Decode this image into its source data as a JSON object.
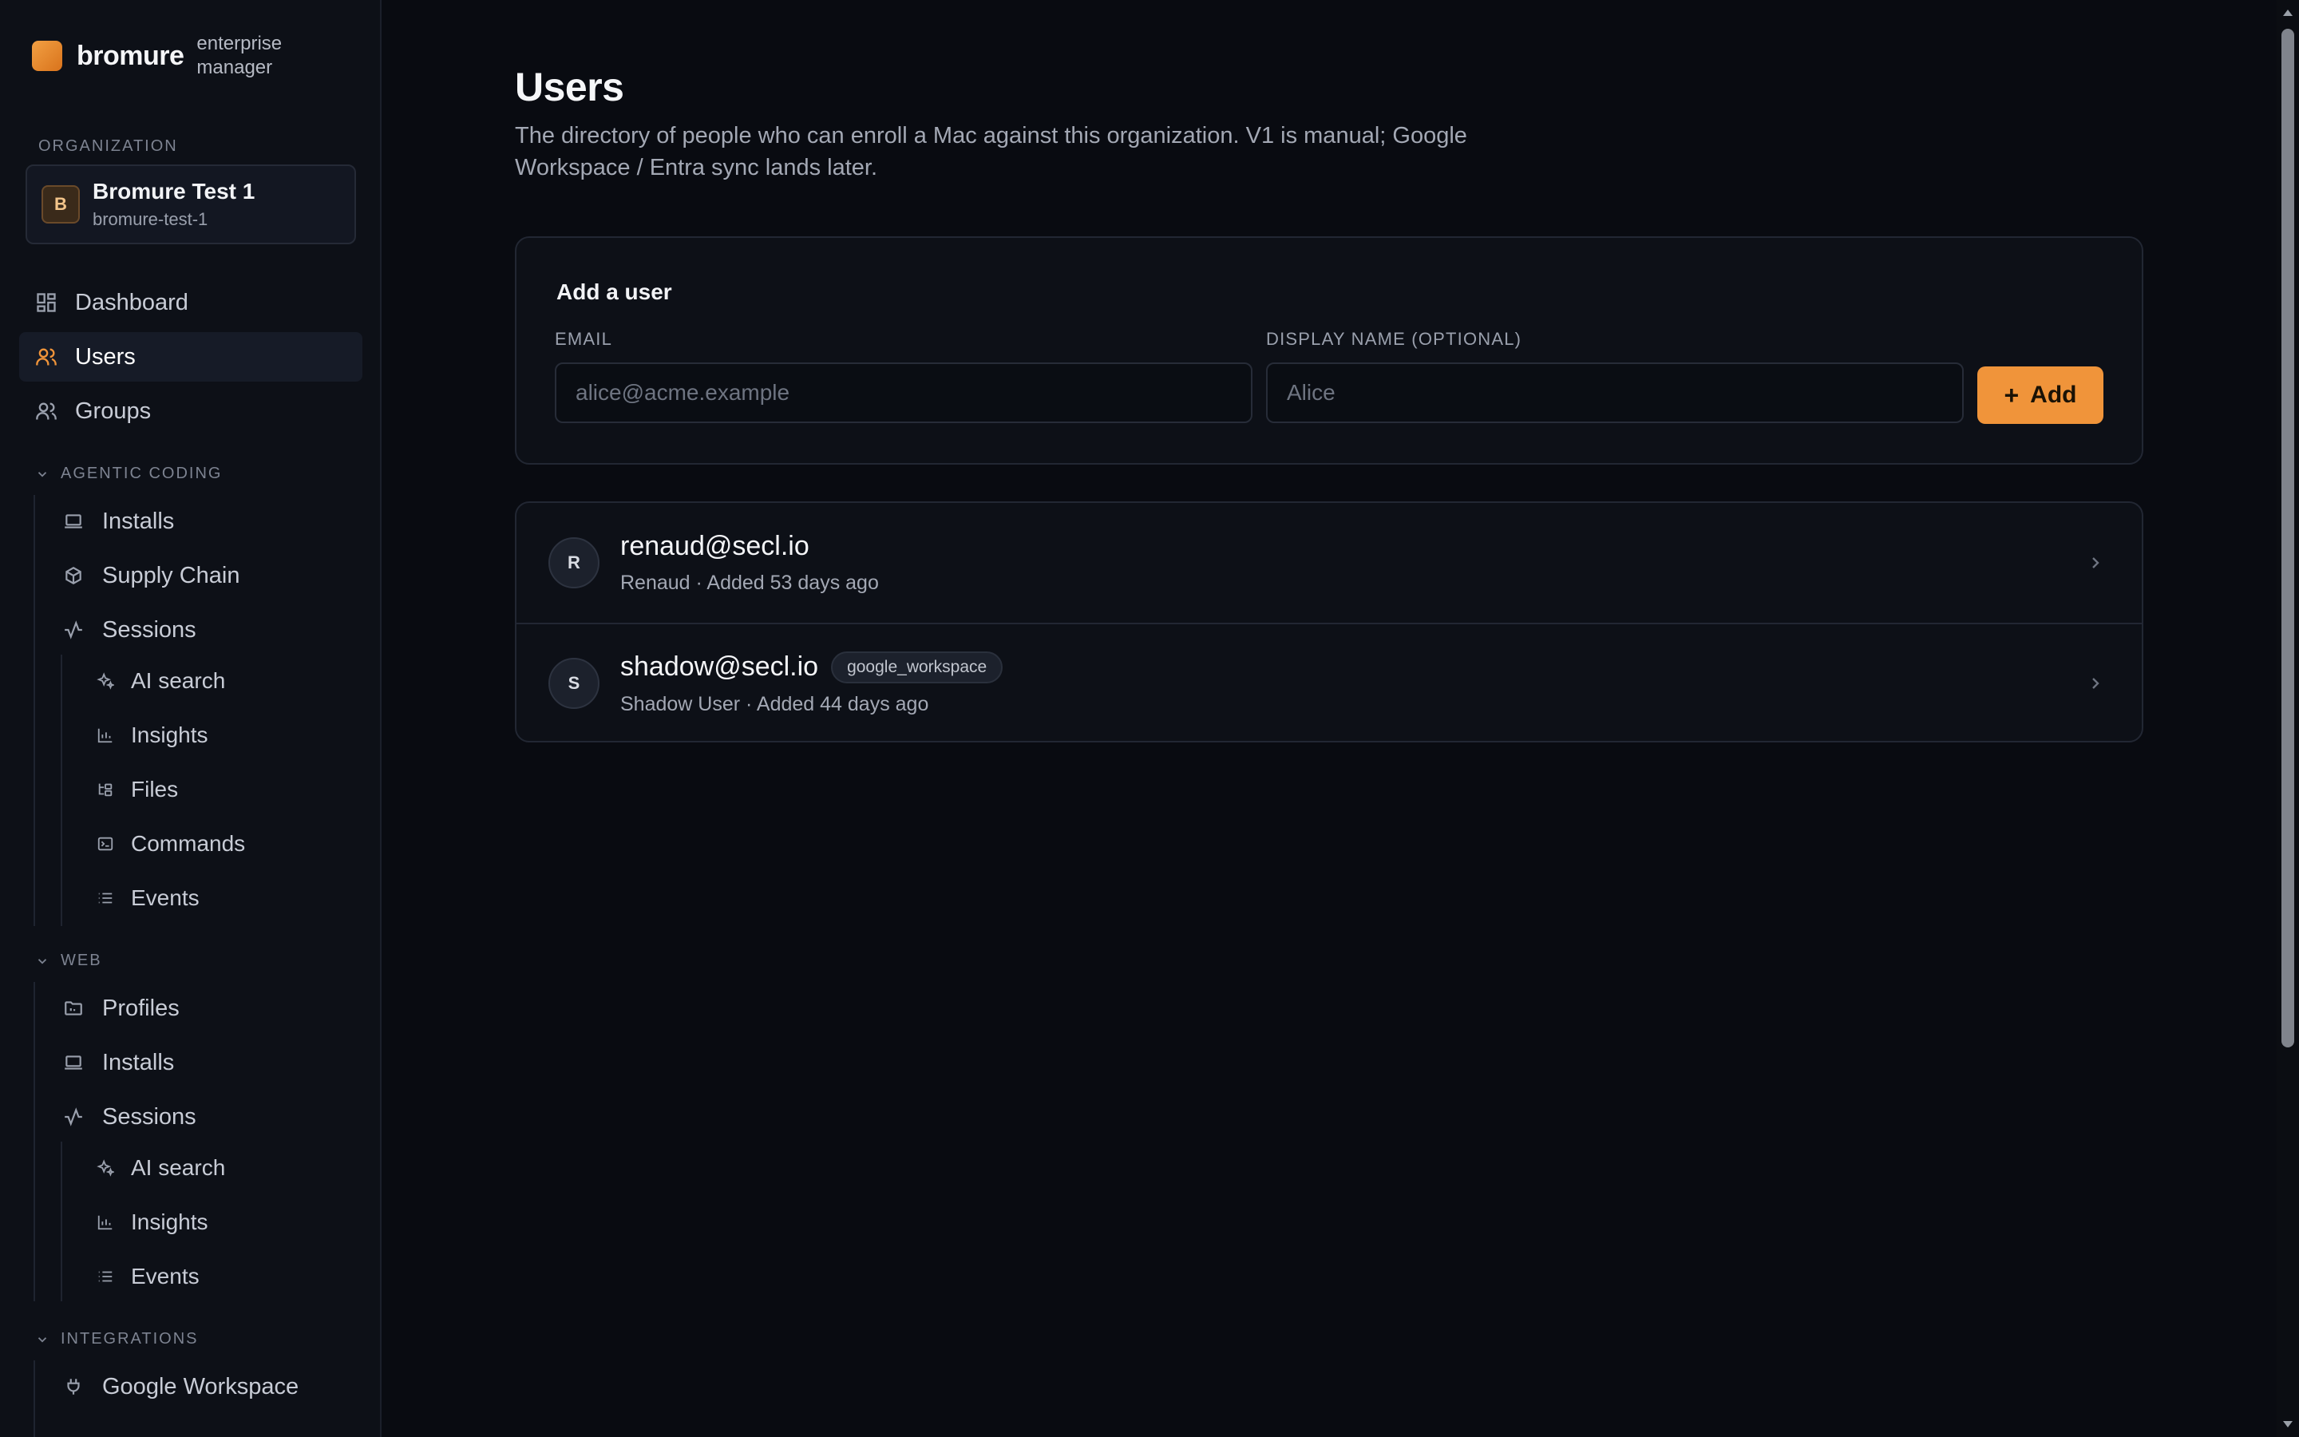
{
  "brand": {
    "name": "bromure",
    "subtitle": "enterprise manager",
    "color": "#f0943a"
  },
  "organization": {
    "label": "ORGANIZATION",
    "avatar": "B",
    "name": "Bromure Test 1",
    "slug": "bromure-test-1"
  },
  "nav": {
    "dashboard": "Dashboard",
    "users": "Users",
    "groups": "Groups",
    "agentic": {
      "title": "AGENTIC CODING",
      "installs": "Installs",
      "supply_chain": "Supply Chain",
      "sessions": "Sessions",
      "ai_search": "AI search",
      "insights": "Insights",
      "files": "Files",
      "commands": "Commands",
      "events": "Events"
    },
    "web": {
      "title": "WEB",
      "profiles": "Profiles",
      "installs": "Installs",
      "sessions": "Sessions",
      "ai_search": "AI search",
      "insights": "Insights",
      "events": "Events"
    },
    "integrations": {
      "title": "INTEGRATIONS",
      "google_workspace": "Google Workspace"
    }
  },
  "page": {
    "title": "Users",
    "description": "The directory of people who can enroll a Mac against this organization. V1 is manual; Google Workspace / Entra sync lands later."
  },
  "add_user": {
    "title": "Add a user",
    "email_label": "EMAIL",
    "email_placeholder": "alice@acme.example",
    "name_label": "DISPLAY NAME (OPTIONAL)",
    "name_placeholder": "Alice",
    "button": "Add"
  },
  "users": [
    {
      "initial": "R",
      "email": "renaud@secl.io",
      "badge": "",
      "meta": "Renaud · Added 53 days ago"
    },
    {
      "initial": "S",
      "email": "shadow@secl.io",
      "badge": "google_workspace",
      "meta": "Shadow User · Added 44 days ago"
    }
  ]
}
